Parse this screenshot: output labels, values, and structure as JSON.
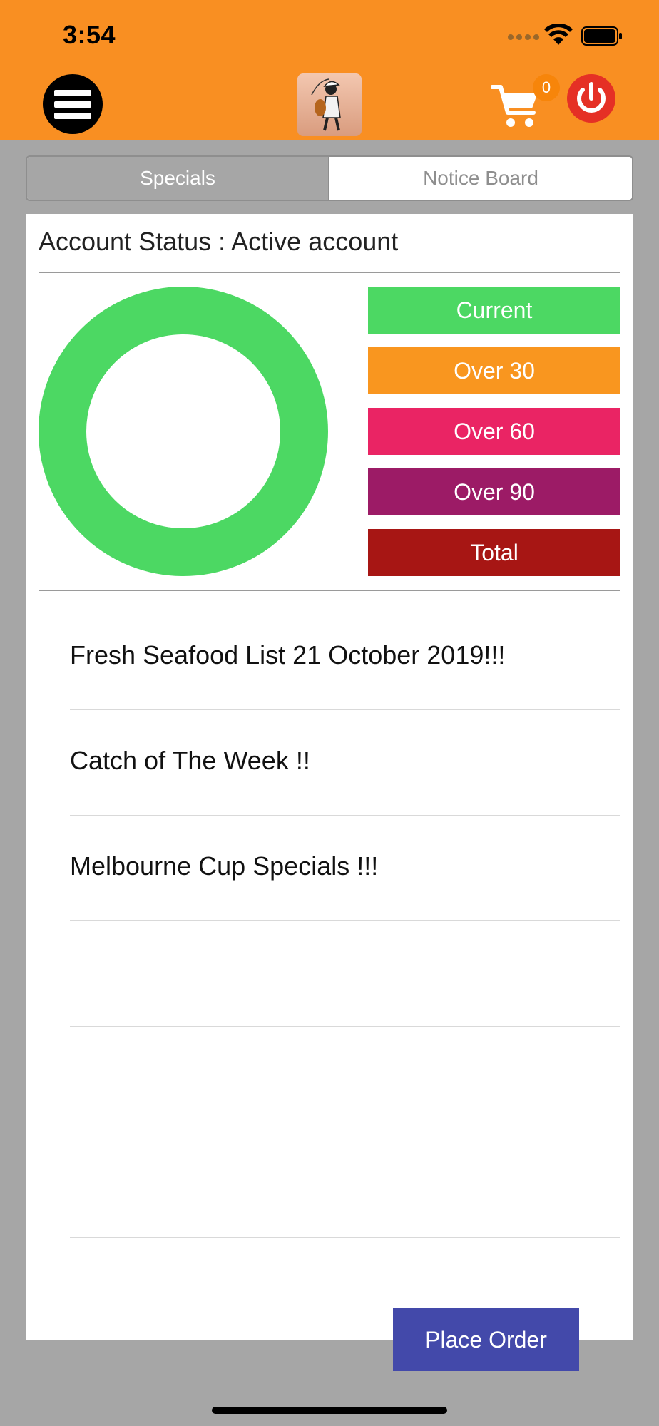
{
  "status_bar": {
    "time": "3:54"
  },
  "header": {
    "cart_count": "0"
  },
  "tabs": [
    {
      "label": "Specials",
      "selected": true
    },
    {
      "label": "Notice Board",
      "selected": false
    }
  ],
  "account": {
    "status_text": "Account Status : Active account"
  },
  "chart_data": {
    "type": "pie",
    "donut": true,
    "slices": [
      {
        "label": "Current",
        "value": 100,
        "color": "#4cd863"
      }
    ]
  },
  "legend": [
    {
      "label": "Current",
      "color": "#4cd863"
    },
    {
      "label": "Over 30",
      "color": "#f9961f"
    },
    {
      "label": "Over 60",
      "color": "#ea2464"
    },
    {
      "label": "Over 90",
      "color": "#9c1b66"
    },
    {
      "label": "Total",
      "color": "#a71614"
    }
  ],
  "list": {
    "items": [
      "Fresh Seafood List 21 October 2019!!!",
      "Catch of The Week !!",
      "Melbourne Cup Specials !!!",
      "",
      "",
      ""
    ]
  },
  "actions": {
    "place_order_label": "Place Order"
  },
  "colors": {
    "header_bg": "#f98f22",
    "page_bg": "#a6a6a6",
    "place_order_bg": "#4349aa"
  }
}
